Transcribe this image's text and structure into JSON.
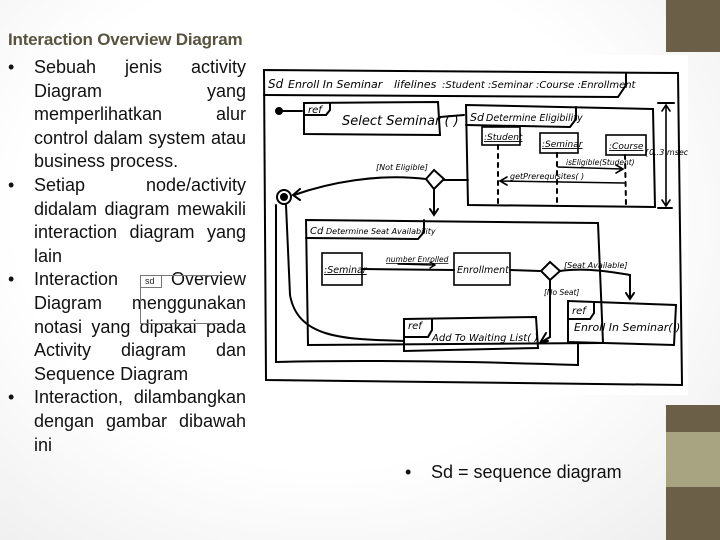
{
  "slide": {
    "title": "Interaction Overview Diagram",
    "bullets": [
      {
        "marker": "•",
        "text": "Sebuah jenis activity Diagram yang memperlihatkan alur control dalam system atau business process."
      },
      {
        "marker": "•",
        "text": "Setiap node/activity didalam diagram mewakili interaction diagram yang lain"
      },
      {
        "marker": "•",
        "text": "Interaction Overview Diagram menggunakan notasi yang dipakai pada Activity diagram dan Sequence Diagram"
      },
      {
        "marker": "•",
        "text": "Interaction, dilambangkan dengan gambar dibawah ini"
      }
    ],
    "sd_frame_tag": "sd",
    "footnote": {
      "marker": "•",
      "text": "Sd = sequence diagram"
    },
    "colors": {
      "title": "#58533f",
      "bar_dark": "#6b5f48",
      "bar_light": "#a8a380"
    }
  },
  "diagram": {
    "outer_frame": {
      "tag": "Sd",
      "name": "Enroll In Seminar",
      "lifelines_label": "lifelines",
      "lifelines": ":Student :Seminar :Course :Enrollment"
    },
    "ref_select": {
      "tag": "ref",
      "label": "Select Seminar ( )"
    },
    "sd_eligibility": {
      "tag": "Sd",
      "name": "Determine Eligibility",
      "objects": [
        ":Student",
        ":Seminar",
        ":Course"
      ],
      "messages": [
        "isEligible(Student)",
        "getPrerequisites( )"
      ],
      "constraint": "{0..3 msec}"
    },
    "guard_not_eligible": "[Not Eligible]",
    "cd_availability": {
      "tag": "Cd",
      "name": "Determine Seat Availability",
      "objects": [
        ":Seminar",
        "Enrollment"
      ],
      "link_label": "number Enrolled"
    },
    "guard_seat_available": "[Seat Available]",
    "guard_no_seat": "[No Seat]",
    "ref_waiting": {
      "tag": "ref",
      "label": "Add To Waiting List( )"
    },
    "ref_enroll": {
      "tag": "ref",
      "label": "Enroll In Seminar( )"
    }
  }
}
